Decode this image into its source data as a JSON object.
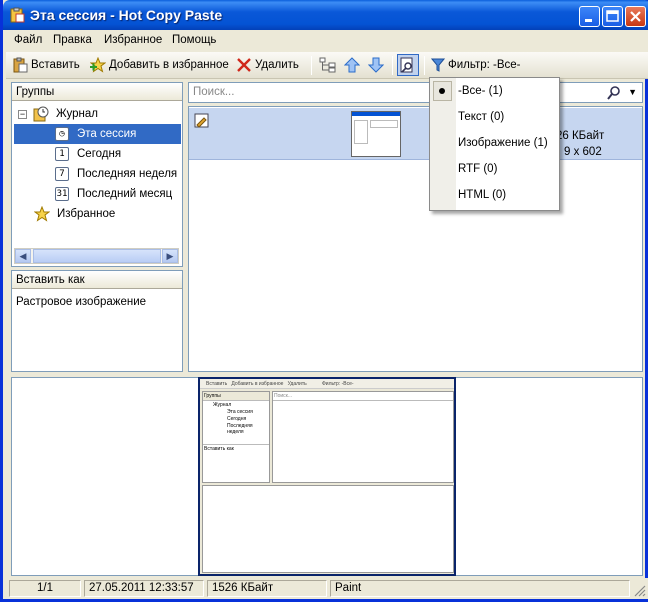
{
  "window": {
    "title": "Эта сессия - Hot Copy Paste"
  },
  "menu": [
    "Файл",
    "Правка",
    "Избранное",
    "Помощь"
  ],
  "toolbar": {
    "paste": "Вставить",
    "add_favorite": "Добавить в избранное",
    "delete": "Удалить",
    "filter": "Фильтр: -Все-"
  },
  "groups": {
    "title": "Группы",
    "journal": "Журнал",
    "items": [
      {
        "icon": "session-icon",
        "label": "Эта сессия"
      },
      {
        "icon": "1",
        "label": "Сегодня"
      },
      {
        "icon": "7",
        "label": "Последняя неделя"
      },
      {
        "icon": "31",
        "label": "Последний месяц"
      }
    ],
    "favorites": "Избранное"
  },
  "paste_as": {
    "title": "Вставить как",
    "option": "Растровое изображение"
  },
  "search": {
    "placeholder": "Поиск..."
  },
  "clip": {
    "size": "26 КБайт",
    "dims": "9 x 602"
  },
  "filter_menu": {
    "items": [
      {
        "label": "-Все- (1)",
        "selected": true
      },
      {
        "label": "Текст (0)"
      },
      {
        "label": "Изображение (1)"
      },
      {
        "label": "RTF (0)"
      },
      {
        "label": "HTML (0)"
      }
    ]
  },
  "preview": {
    "paste": "Вставить",
    "add": "Добавить в избранное",
    "delete": "Удалить",
    "filter": "Фильтр: -Все-",
    "groups": "Группы",
    "journal": "Журнал",
    "session": "Эта сессия",
    "today": "Сегодня",
    "week": "Последняя неделя",
    "paste_as": "Вставить как",
    "search": "Поиск..."
  },
  "status": {
    "index": "1/1",
    "datetime": "27.05.2011 12:33:57",
    "size": "1526 КБайт",
    "source": "Paint"
  },
  "colors": {
    "titlebar": "#0453d4",
    "selection": "#316ac5",
    "accent": "#c6d6f0"
  }
}
